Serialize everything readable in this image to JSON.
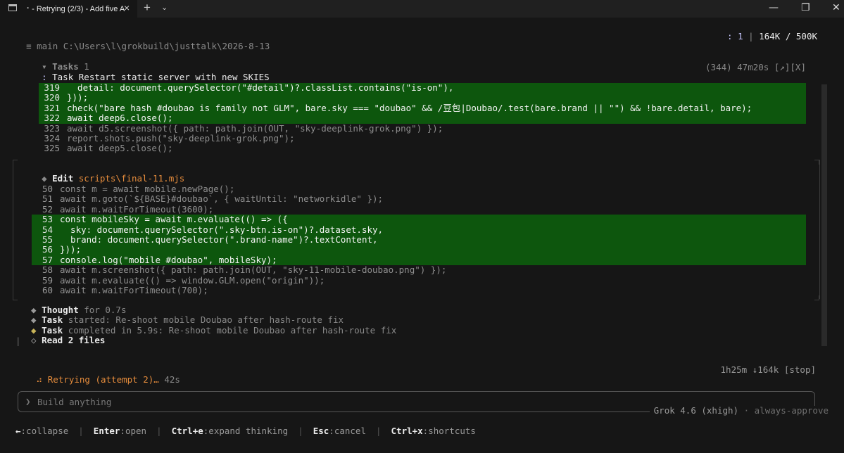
{
  "window": {
    "tab_title": "⠐ - Retrying (2/3) - Add five A",
    "close_glyph": "×",
    "new_tab_glyph": "+",
    "dropdown_glyph": "⌄",
    "minimize_glyph": "—",
    "maximize_glyph": "❐",
    "close_window_glyph": "✕"
  },
  "header": {
    "menu_glyph": "≡",
    "branch": "main",
    "path": "C:\\Users\\l\\grokbuild\\justtalk\\2026-8-13",
    "tokens_prefix": ": 1 ",
    "divider": "|",
    "tokens": " 164K / 500K"
  },
  "tasks": {
    "caret": "▾",
    "label": "Tasks",
    "count": "1",
    "current_prefix": ": ",
    "current_label": "Task",
    "current_text": "Restart static server with new SKIES",
    "meta": "(344) 47m20s [↗][X]"
  },
  "code_block_1": [
    {
      "n": "319",
      "text": "  detail: document.querySelector(\"#detail\")?.classList.contains(\"is-on\"),",
      "hl": true
    },
    {
      "n": "320",
      "text": "}));",
      "hl": true
    },
    {
      "n": "321",
      "text": "check(\"bare hash #doubao is family not GLM\", bare.sky === \"doubao\" && /豆包|Doubao/.test(bare.brand || \"\") && !bare.detail, bare);",
      "hl": true
    },
    {
      "n": "322",
      "text": "await deep6.close();",
      "hl": true
    },
    {
      "n": "323",
      "text": "await d5.screenshot({ path: path.join(OUT, \"sky-deeplink-grok.png\") });",
      "hl": false
    },
    {
      "n": "324",
      "text": "report.shots.push(\"sky-deeplink-grok.png\");",
      "hl": false
    },
    {
      "n": "325",
      "text": "await deep5.close();",
      "hl": false
    }
  ],
  "edit": {
    "bullet": "◆",
    "label": "Edit",
    "path": "scripts\\final-11.mjs"
  },
  "code_block_2": [
    {
      "n": "50",
      "text": "const m = await mobile.newPage();",
      "hl": false
    },
    {
      "n": "51",
      "text": "await m.goto(`${BASE}#doubao`, { waitUntil: \"networkidle\" });",
      "hl": false
    },
    {
      "n": "52",
      "text": "await m.waitForTimeout(3600);",
      "hl": false
    },
    {
      "n": "53",
      "text": "const mobileSky = await m.evaluate(() => ({",
      "hl": true
    },
    {
      "n": "54",
      "text": "  sky: document.querySelector(\".sky-btn.is-on\")?.dataset.sky,",
      "hl": true
    },
    {
      "n": "55",
      "text": "  brand: document.querySelector(\".brand-name\")?.textContent,",
      "hl": true
    },
    {
      "n": "56",
      "text": "}));",
      "hl": true
    },
    {
      "n": "57",
      "text": "console.log(\"mobile #doubao\", mobileSky);",
      "hl": true
    },
    {
      "n": "58",
      "text": "await m.screenshot({ path: path.join(OUT, \"sky-11-mobile-doubao.png\") });",
      "hl": false
    },
    {
      "n": "59",
      "text": "await m.evaluate(() => window.GLM.open(\"origin\"));",
      "hl": false
    },
    {
      "n": "60",
      "text": "await m.waitForTimeout(700);",
      "hl": false
    }
  ],
  "progress": [
    {
      "bullet": "◆",
      "label": "Thought",
      "text": " for 0.7s",
      "bullet_color": "#9a9a9a"
    },
    {
      "bullet": "◆",
      "label": "Task",
      "text": " started: Re-shoot mobile Doubao after hash-route fix",
      "bullet_color": "#9a9a9a"
    },
    {
      "bullet": "◆",
      "label": "Task",
      "text": " completed in 5.9s: Re-shoot mobile Doubao after hash-route fix",
      "bullet_color": "#c9b458"
    },
    {
      "bullet": "◇",
      "label": "Read 2 files",
      "text": "",
      "bullet_color": "#9a9a9a"
    }
  ],
  "read_bar_glyph": "|",
  "status": {
    "spinner": "⠴",
    "text": "Retrying (attempt 2)…",
    "elapsed": " 42s",
    "stats": "1h25m ↓164k [stop]"
  },
  "input": {
    "prompt_glyph": "❯",
    "placeholder": "Build anything"
  },
  "model": {
    "name": "Grok 4.6 (xhigh)",
    "sep": " · ",
    "mode": "always-approve"
  },
  "shortcuts": [
    {
      "key": "←",
      "action": ":collapse"
    },
    {
      "key": "Enter",
      "action": ":open"
    },
    {
      "key": "Ctrl+e",
      "action": ":expand thinking"
    },
    {
      "key": "Esc",
      "action": ":cancel"
    },
    {
      "key": "Ctrl+x",
      "action": ":shortcuts"
    }
  ],
  "colors": {
    "background": "#161616",
    "highlight": "#0d560d",
    "accent": "#e58c3c",
    "task_complete": "#c9b458"
  }
}
